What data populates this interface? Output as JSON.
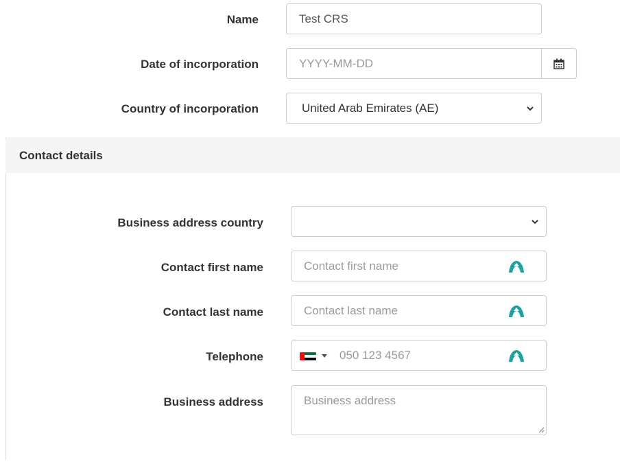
{
  "company": {
    "name_label": "Name",
    "name_value": "Test CRS",
    "date_label": "Date of incorporation",
    "date_placeholder": "YYYY-MM-DD",
    "country_label": "Country of incorporation",
    "country_value": "United Arab Emirates (AE)"
  },
  "contact": {
    "panel_title": "Contact details",
    "business_country_label": "Business address country",
    "business_country_value": "",
    "first_name_label": "Contact first name",
    "first_name_placeholder": "Contact first name",
    "last_name_label": "Contact last name",
    "last_name_placeholder": "Contact last name",
    "telephone_label": "Telephone",
    "telephone_placeholder": "050 123 4567",
    "telephone_country_flag": "uae-flag-icon",
    "address_label": "Business address",
    "address_placeholder": "Business address"
  },
  "icons": {
    "calendar": "calendar-icon",
    "chevron": "chevron-down-icon",
    "autofill": "lastpass-icon",
    "resize": "resize-handle-icon"
  },
  "colors": {
    "autofill_teal": "#1aa3a3",
    "panel_header_bg": "#f5f5f5",
    "border": "#cccccc"
  }
}
